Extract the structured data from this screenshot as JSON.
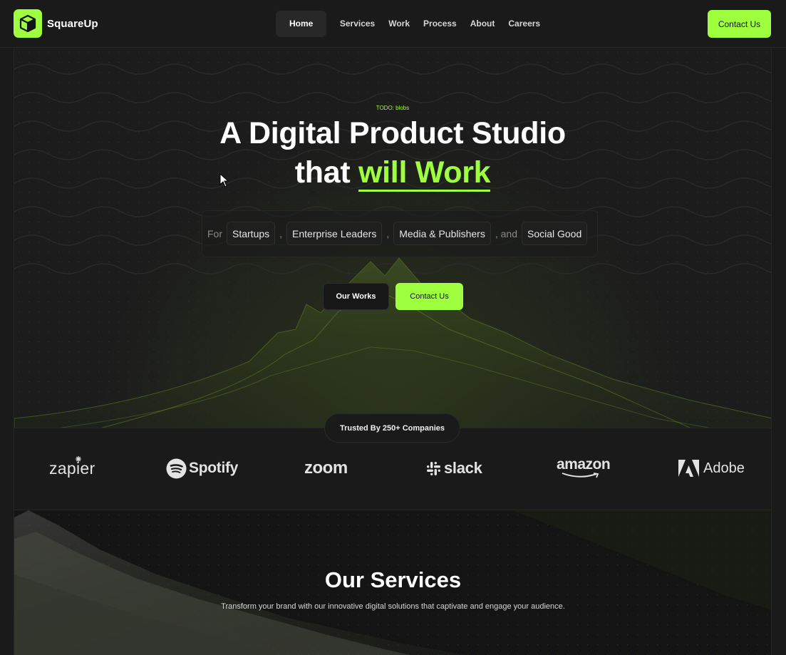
{
  "nav": {
    "brand": "SquareUp",
    "items": [
      {
        "label": "Home",
        "active": true
      },
      {
        "label": "Services"
      },
      {
        "label": "Work"
      },
      {
        "label": "Process"
      },
      {
        "label": "About"
      },
      {
        "label": "Careers"
      }
    ],
    "cta": "Contact Us"
  },
  "hero": {
    "todo": "TODO: blobs",
    "title_line1": "A Digital Product Studio",
    "title_line2_prefix": "that ",
    "title_line2_accent": "will Work",
    "for_label": "For",
    "audiences": [
      "Startups",
      "Enterprise Leaders",
      "Media & Publishers",
      "Social Good"
    ],
    "sep_comma": ",",
    "sep_and": ", and",
    "btn_works": "Our Works",
    "btn_contact": "Contact Us"
  },
  "trusted": {
    "badge": "Trusted By 250+ Companies",
    "brands": [
      "zapier",
      "Spotify",
      "zoom",
      "slack",
      "amazon",
      "Adobe"
    ]
  },
  "services": {
    "title": "Our Services",
    "subtitle": "Transform your brand with our innovative digital solutions that captivate and engage your audience."
  },
  "colors": {
    "accent": "#9eff3f",
    "background": "#1a1a1a"
  }
}
